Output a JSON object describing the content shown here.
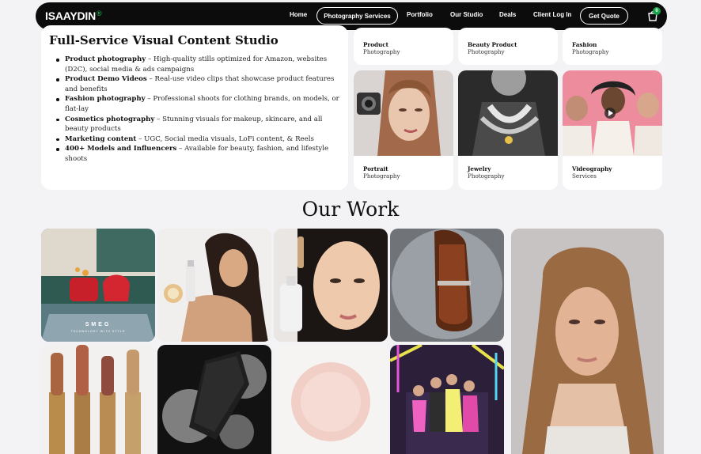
{
  "nav": {
    "logo": "ISAAYDIN",
    "logo_mark": "®",
    "items": [
      "Home",
      "Photography Services",
      "Portfolio",
      "Our Studio",
      "Deals",
      "Client Log In"
    ],
    "cta": "Get Quote",
    "cart_count": "0"
  },
  "services": {
    "title": "Full-Service Visual Content Studio",
    "items": [
      {
        "bold": "Product photography",
        "text": " – High-quality stills optimized for Amazon, websites (D2C), social media & ads campaigns"
      },
      {
        "bold": "Product Demo Videos",
        "text": " – Real-use video clips that showcase product features and benefits"
      },
      {
        "bold": "Fashion photography",
        "text": " – Professional shoots for clothing brands, on models, or flat-lay"
      },
      {
        "bold": "Cosmetics photography",
        "text": " – Stunning visuals for makeup, skincare, and all beauty products"
      },
      {
        "bold": "Marketing content",
        "text": " – UGC, Social media visuals, LoFi content, & Reels"
      },
      {
        "bold": "400+ Models and Influencers",
        "text": " – Available for beauty, fashion, and lifestyle shoots"
      }
    ]
  },
  "categories": [
    {
      "title": "Product",
      "sub": "Photography"
    },
    {
      "title": "Beauty Product",
      "sub": "Photography"
    },
    {
      "title": "Fashion",
      "sub": "Photography"
    },
    {
      "title": "Portrait",
      "sub": "Photography"
    },
    {
      "title": "Jewelry",
      "sub": "Photography"
    },
    {
      "title": "Videography",
      "sub": "Services"
    }
  ],
  "our_work": {
    "title": "Our Work",
    "smeg_brand": "SMEG",
    "smeg_tagline": "TECHNOLOGY WITH STYLE"
  },
  "colors": {
    "nav_bg": "#0c0c0c",
    "accent_green": "#1aa34a",
    "page_bg": "#f3f2f5"
  },
  "icons": [
    "cart-icon",
    "play-icon"
  ]
}
